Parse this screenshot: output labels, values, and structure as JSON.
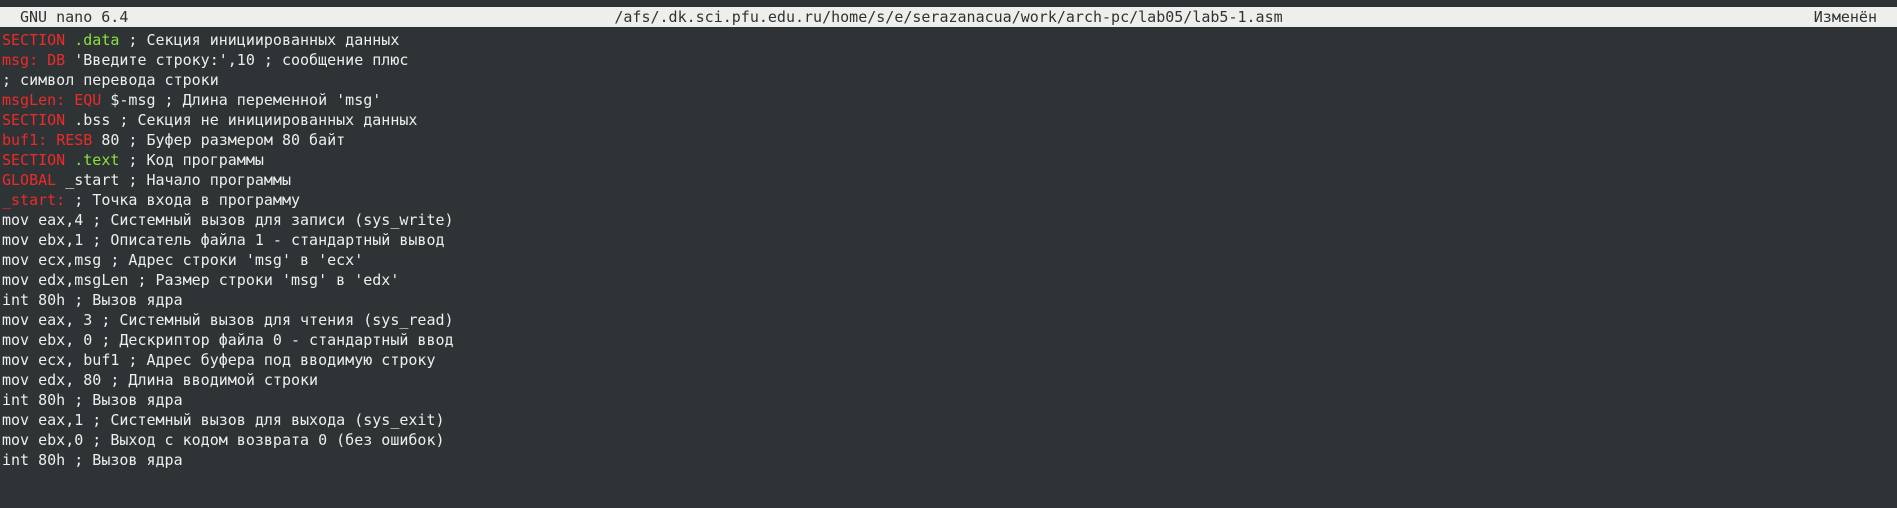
{
  "titlebar": {
    "app": "GNU nano 6.4",
    "path": "/afs/.dk.sci.pfu.edu.ru/home/s/e/serazanacua/work/arch-pc/lab05/lab5-1.asm",
    "status": "Изменён"
  },
  "colors": {
    "background": "#2e3436",
    "titlebar_bg": "#eeeeec",
    "text": "#eeeeec",
    "keyword_red": "#ef2929",
    "keyword_green": "#8ae234"
  },
  "lines": [
    [
      {
        "t": "SECTION",
        "c": "red"
      },
      {
        "t": " ",
        "c": "txt"
      },
      {
        "t": ".data",
        "c": "green"
      },
      {
        "t": " ; Секция инициированных данных",
        "c": "txt"
      }
    ],
    [
      {
        "t": "msg:",
        "c": "red"
      },
      {
        "t": " ",
        "c": "txt"
      },
      {
        "t": "DB",
        "c": "red"
      },
      {
        "t": " 'Введите строку:',10 ; сообщение плюс",
        "c": "txt"
      }
    ],
    [
      {
        "t": "; символ перевода строки",
        "c": "txt"
      }
    ],
    [
      {
        "t": "msgLen:",
        "c": "red"
      },
      {
        "t": " ",
        "c": "txt"
      },
      {
        "t": "EQU",
        "c": "red"
      },
      {
        "t": " $-msg ; Длина переменной 'msg'",
        "c": "txt"
      }
    ],
    [
      {
        "t": "SECTION",
        "c": "red"
      },
      {
        "t": " .bss ; Секция не инициированных данных",
        "c": "txt"
      }
    ],
    [
      {
        "t": "buf1:",
        "c": "red"
      },
      {
        "t": " ",
        "c": "txt"
      },
      {
        "t": "RESB",
        "c": "red"
      },
      {
        "t": " 80 ; Буфер размером 80 байт",
        "c": "txt"
      }
    ],
    [
      {
        "t": "SECTION",
        "c": "red"
      },
      {
        "t": " ",
        "c": "txt"
      },
      {
        "t": ".text",
        "c": "green"
      },
      {
        "t": " ; Код программы",
        "c": "txt"
      }
    ],
    [
      {
        "t": "GLOBAL",
        "c": "red"
      },
      {
        "t": " _start ; Начало программы",
        "c": "txt"
      }
    ],
    [
      {
        "t": "_start:",
        "c": "red"
      },
      {
        "t": " ; Точка входа в программу",
        "c": "txt"
      }
    ],
    [
      {
        "t": "mov eax,4 ; Системный вызов для записи (sys_write)",
        "c": "txt"
      }
    ],
    [
      {
        "t": "mov ebx,1 ; Описатель файла 1 - стандартный вывод",
        "c": "txt"
      }
    ],
    [
      {
        "t": "mov ecx,msg ; Адрес строки 'msg' в 'ecx'",
        "c": "txt"
      }
    ],
    [
      {
        "t": "mov edx,msgLen ; Размер строки 'msg' в 'edx'",
        "c": "txt"
      }
    ],
    [
      {
        "t": "int 80h ; Вызов ядра",
        "c": "txt"
      }
    ],
    [
      {
        "t": "mov eax, 3 ; Системный вызов для чтения (sys_read)",
        "c": "txt"
      }
    ],
    [
      {
        "t": "mov ebx, 0 ; Дескриптор файла 0 - стандартный ввод",
        "c": "txt"
      }
    ],
    [
      {
        "t": "mov ecx, buf1 ; Адрес буфера под вводимую строку",
        "c": "txt"
      }
    ],
    [
      {
        "t": "mov edx, 80 ; Длина вводимой строки",
        "c": "txt"
      }
    ],
    [
      {
        "t": "int 80h ; Вызов ядра",
        "c": "txt"
      }
    ],
    [
      {
        "t": "mov eax,1 ; Системный вызов для выхода (sys_exit)",
        "c": "txt"
      }
    ],
    [
      {
        "t": "mov ebx,0 ; Выход с кодом возврата 0 (без ошибок)",
        "c": "txt"
      }
    ],
    [
      {
        "t": "int 80h ; Вызов ядра",
        "c": "txt"
      }
    ]
  ]
}
